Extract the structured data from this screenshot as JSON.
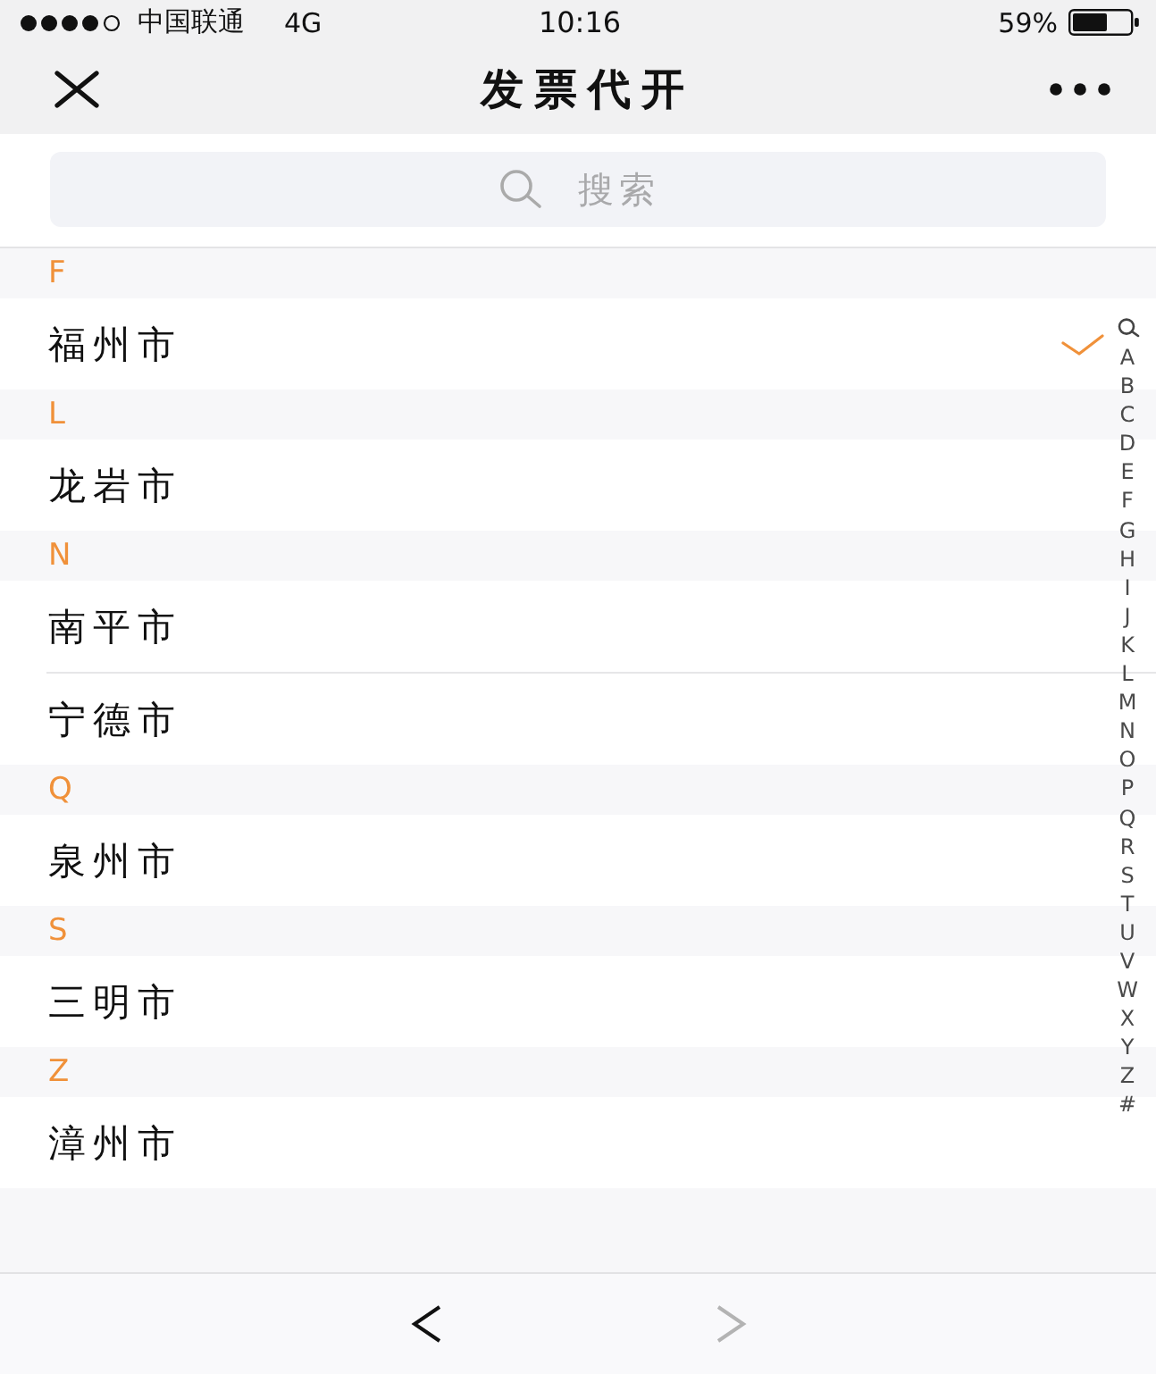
{
  "status_bar": {
    "carrier": "中国联通",
    "network": "4G",
    "time": "10:16",
    "battery": "59%"
  },
  "nav_bar": {
    "title": "发票代开"
  },
  "search": {
    "placeholder": "搜索"
  },
  "sections": [
    {
      "letter": "F",
      "cities": [
        {
          "name": "福州市",
          "selected": true
        }
      ]
    },
    {
      "letter": "L",
      "cities": [
        {
          "name": "龙岩市",
          "selected": false
        }
      ]
    },
    {
      "letter": "N",
      "cities": [
        {
          "name": "南平市",
          "selected": false
        },
        {
          "name": "宁德市",
          "selected": false
        }
      ]
    },
    {
      "letter": "Q",
      "cities": [
        {
          "name": "泉州市",
          "selected": false
        }
      ]
    },
    {
      "letter": "S",
      "cities": [
        {
          "name": "三明市",
          "selected": false
        }
      ]
    },
    {
      "letter": "Z",
      "cities": [
        {
          "name": "漳州市",
          "selected": false
        }
      ]
    }
  ],
  "index_bar": {
    "letters": [
      "A",
      "B",
      "C",
      "D",
      "E",
      "F",
      "G",
      "H",
      "I",
      "J",
      "K",
      "L",
      "M",
      "N",
      "O",
      "P",
      "Q",
      "R",
      "S",
      "T",
      "U",
      "V",
      "W",
      "X",
      "Y",
      "Z",
      "#"
    ]
  },
  "bottom_bar": {
    "back": {
      "disabled": false
    },
    "forward": {
      "disabled": true
    }
  }
}
